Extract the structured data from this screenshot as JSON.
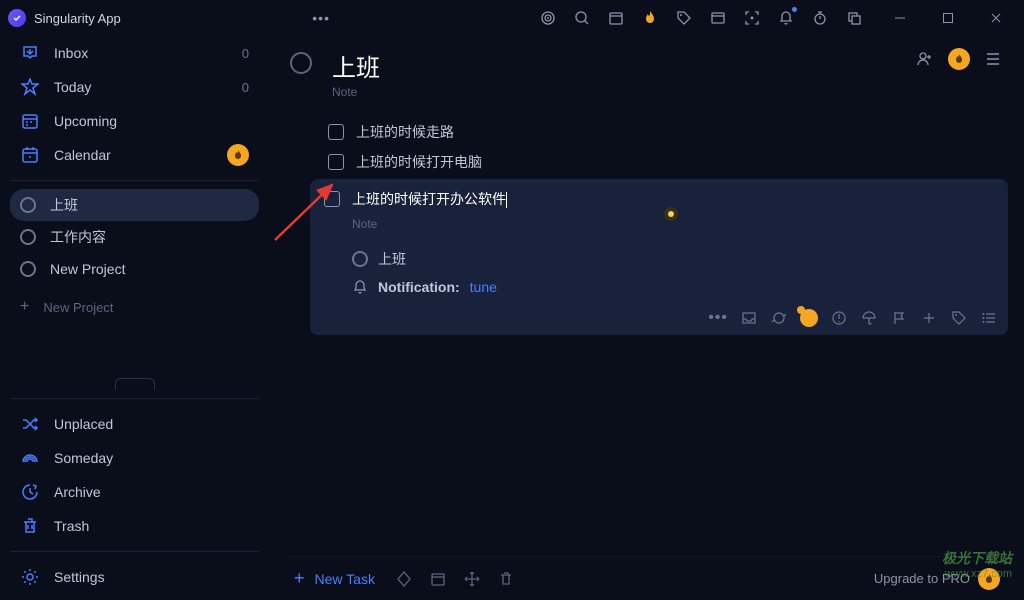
{
  "app": {
    "title": "Singularity App"
  },
  "sidebar": {
    "inbox": {
      "label": "Inbox",
      "count": "0"
    },
    "today": {
      "label": "Today",
      "count": "0"
    },
    "upcoming": {
      "label": "Upcoming"
    },
    "calendar": {
      "label": "Calendar"
    },
    "projects": [
      {
        "label": "上班"
      },
      {
        "label": "工作内容"
      },
      {
        "label": "New Project"
      }
    ],
    "new_project": "New Project",
    "unplaced": "Unplaced",
    "someday": "Someday",
    "archive": "Archive",
    "trash": "Trash",
    "settings": "Settings"
  },
  "list": {
    "title": "上班",
    "note_label": "Note",
    "tasks": [
      {
        "title": "上班的时候走路"
      },
      {
        "title": "上班的时候打开电脑"
      }
    ],
    "editing_task": {
      "title": "上班的时候打开办公软件",
      "note_label": "Note",
      "project": "上班",
      "notification_label": "Notification:",
      "notification_value": "tune"
    }
  },
  "bottom": {
    "new_task": "New Task",
    "upgrade": "Upgrade to PRO"
  },
  "watermark": {
    "line1": "极光下载站",
    "line2": "www.xz7.com"
  }
}
